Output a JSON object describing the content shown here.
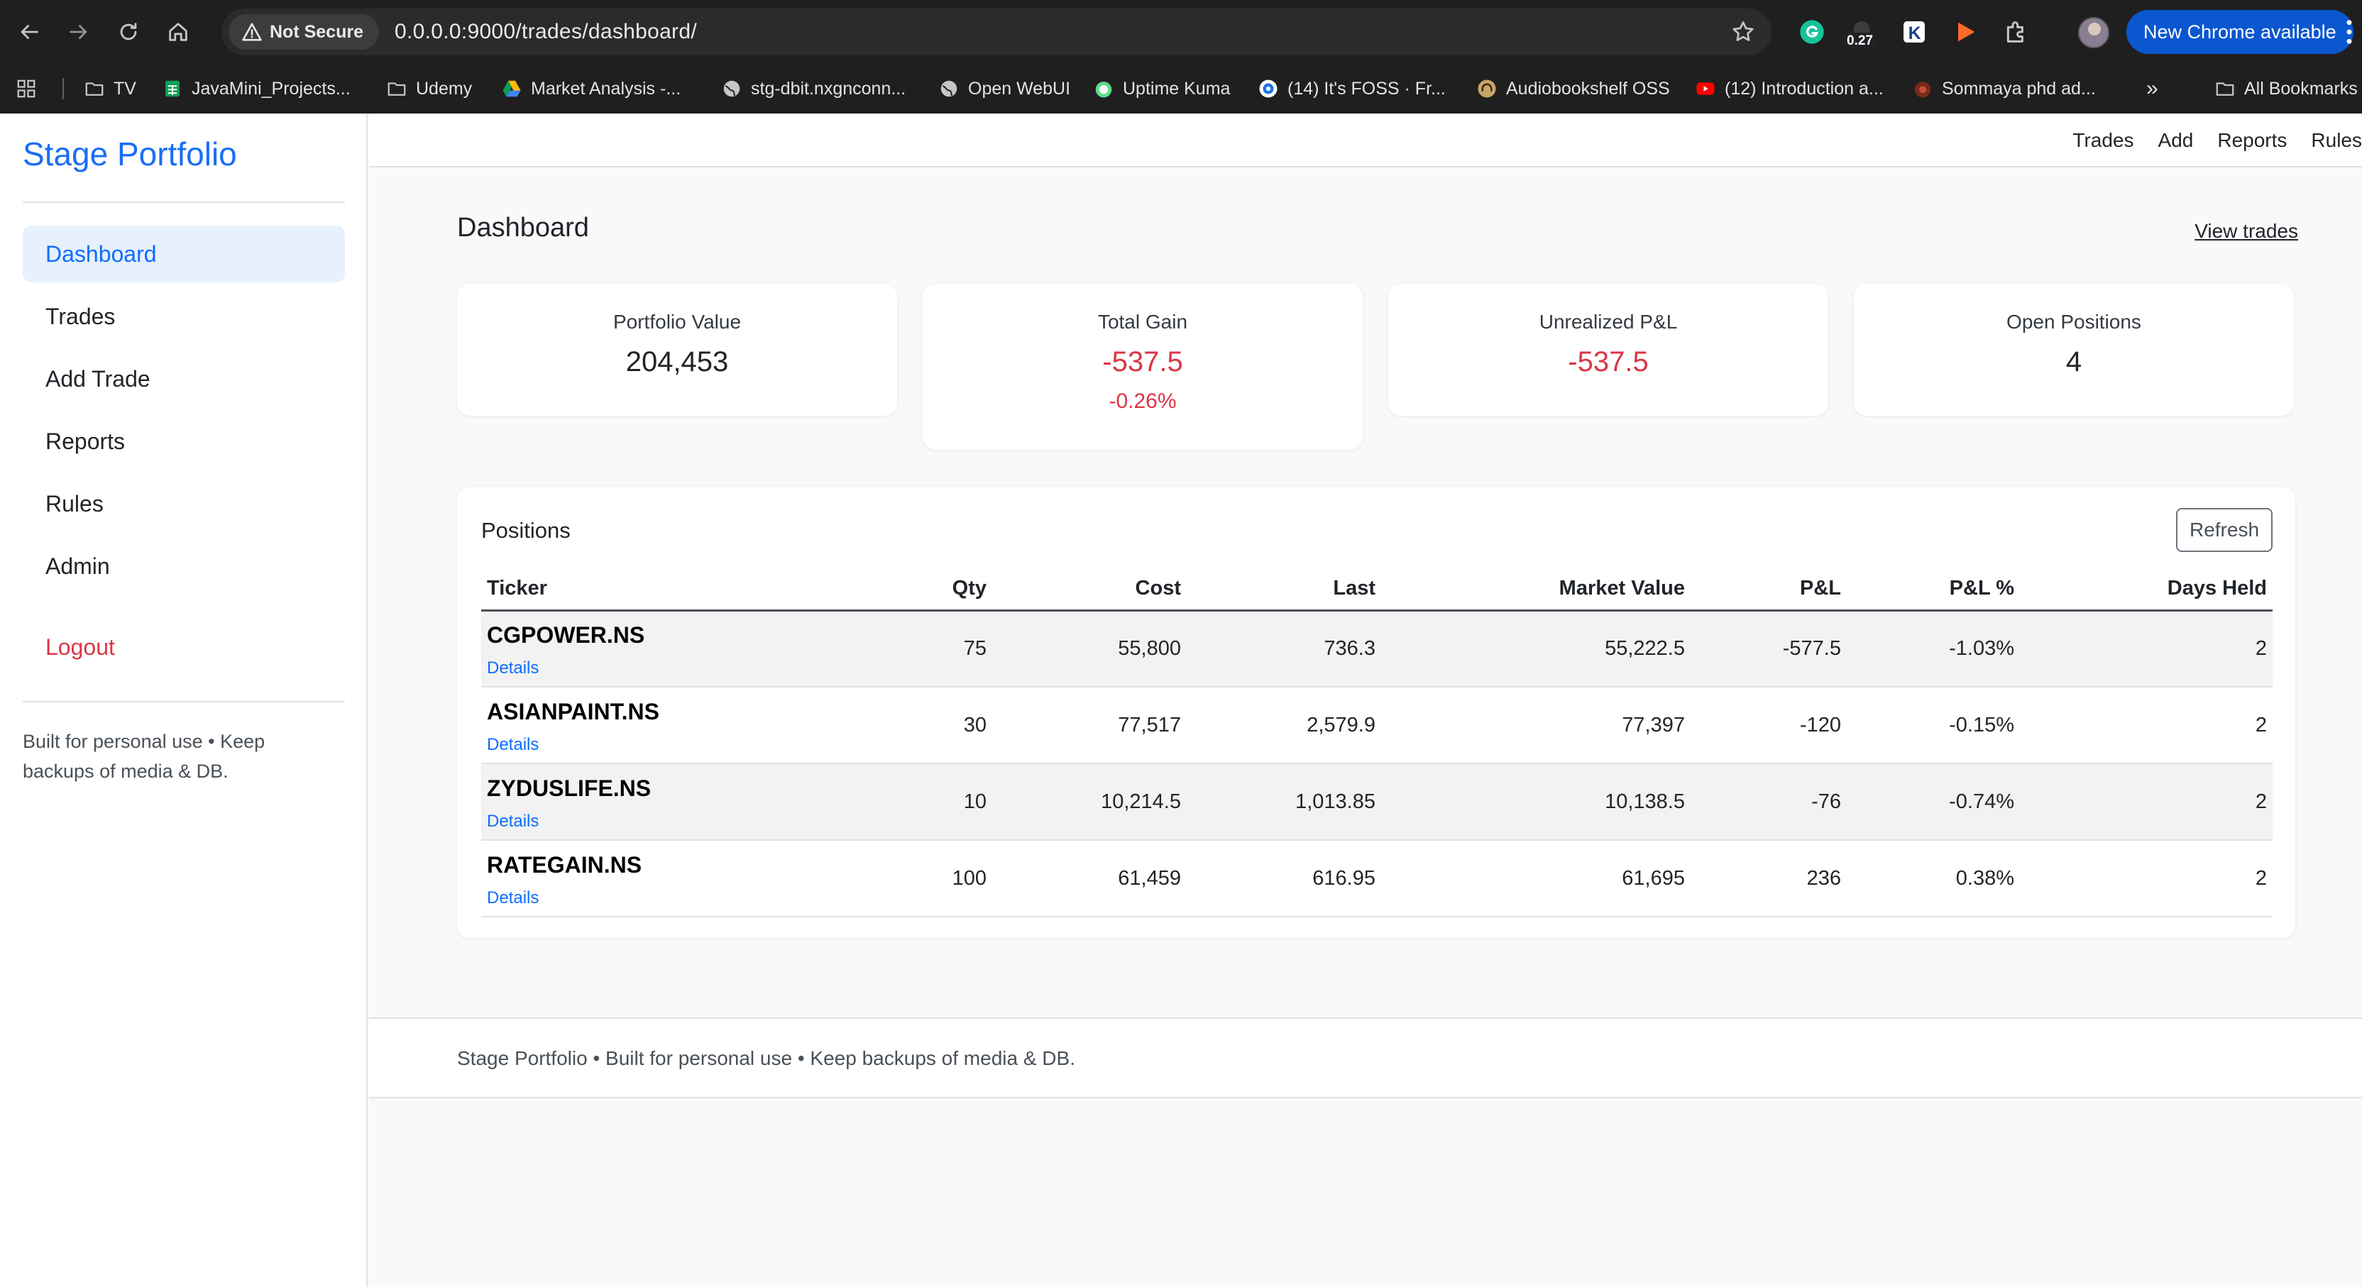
{
  "browser": {
    "security_label": "Not Secure",
    "url": "0.0.0.0:9000/trades/dashboard/",
    "extension_badge": "0.27",
    "update_button": "New Chrome available"
  },
  "bookmarks": [
    {
      "label": "TV",
      "icon": "folder-icon"
    },
    {
      "label": "JavaMini_Projects...",
      "icon": "sheets-icon"
    },
    {
      "label": "Udemy",
      "icon": "folder-icon"
    },
    {
      "label": "Market Analysis -...",
      "icon": "drive-icon"
    },
    {
      "label": "stg-dbit.nxgnconn...",
      "icon": "globe-icon"
    },
    {
      "label": "Open WebUI",
      "icon": "globe-icon"
    },
    {
      "label": "Uptime Kuma",
      "icon": "kuma-icon"
    },
    {
      "label": "(14) It's FOSS · Fr...",
      "icon": "foss-icon"
    },
    {
      "label": "Audiobookshelf OSS",
      "icon": "audiobook-icon"
    },
    {
      "label": "(12) Introduction a...",
      "icon": "youtube-icon"
    },
    {
      "label": "Sommaya phd ad...",
      "icon": "reddit-icon"
    },
    {
      "label": "All Bookmarks",
      "icon": "folder-icon"
    }
  ],
  "sidebar": {
    "brand": "Stage Portfolio",
    "items": [
      {
        "label": "Dashboard",
        "active": true
      },
      {
        "label": "Trades"
      },
      {
        "label": "Add Trade"
      },
      {
        "label": "Reports"
      },
      {
        "label": "Rules"
      },
      {
        "label": "Admin"
      }
    ],
    "logout": "Logout",
    "note": "Built for personal use • Keep backups of media & DB."
  },
  "topnav": [
    "Trades",
    "Add",
    "Reports",
    "Rules"
  ],
  "main": {
    "title": "Dashboard",
    "view_trades": "View trades"
  },
  "cards": [
    {
      "label": "Portfolio Value",
      "value": "204,453"
    },
    {
      "label": "Total Gain",
      "value": "-537.5",
      "sub": "-0.26%"
    },
    {
      "label": "Unrealized P&L",
      "value": "-537.5"
    },
    {
      "label": "Open Positions",
      "value": "4"
    }
  ],
  "positions": {
    "title": "Positions",
    "refresh": "Refresh",
    "columns": [
      "Ticker",
      "Qty",
      "Cost",
      "Last",
      "Market Value",
      "P&L",
      "P&L %",
      "Days Held"
    ],
    "details_label": "Details",
    "rows": [
      {
        "ticker": "CGPOWER.NS",
        "qty": "75",
        "cost": "55,800",
        "last": "736.3",
        "mv": "55,222.5",
        "pnl": "-577.5",
        "pnl_pct": "-1.03%",
        "days": "2",
        "dir": "neg"
      },
      {
        "ticker": "ASIANPAINT.NS",
        "qty": "30",
        "cost": "77,517",
        "last": "2,579.9",
        "mv": "77,397",
        "pnl": "-120",
        "pnl_pct": "-0.15%",
        "days": "2",
        "dir": "neg"
      },
      {
        "ticker": "ZYDUSLIFE.NS",
        "qty": "10",
        "cost": "10,214.5",
        "last": "1,013.85",
        "mv": "10,138.5",
        "pnl": "-76",
        "pnl_pct": "-0.74%",
        "days": "2",
        "dir": "neg"
      },
      {
        "ticker": "RATEGAIN.NS",
        "qty": "100",
        "cost": "61,459",
        "last": "616.95",
        "mv": "61,695",
        "pnl": "236",
        "pnl_pct": "0.38%",
        "days": "2",
        "dir": "pos"
      }
    ]
  },
  "footer": "Stage Portfolio • Built for personal use • Keep backups of media & DB."
}
